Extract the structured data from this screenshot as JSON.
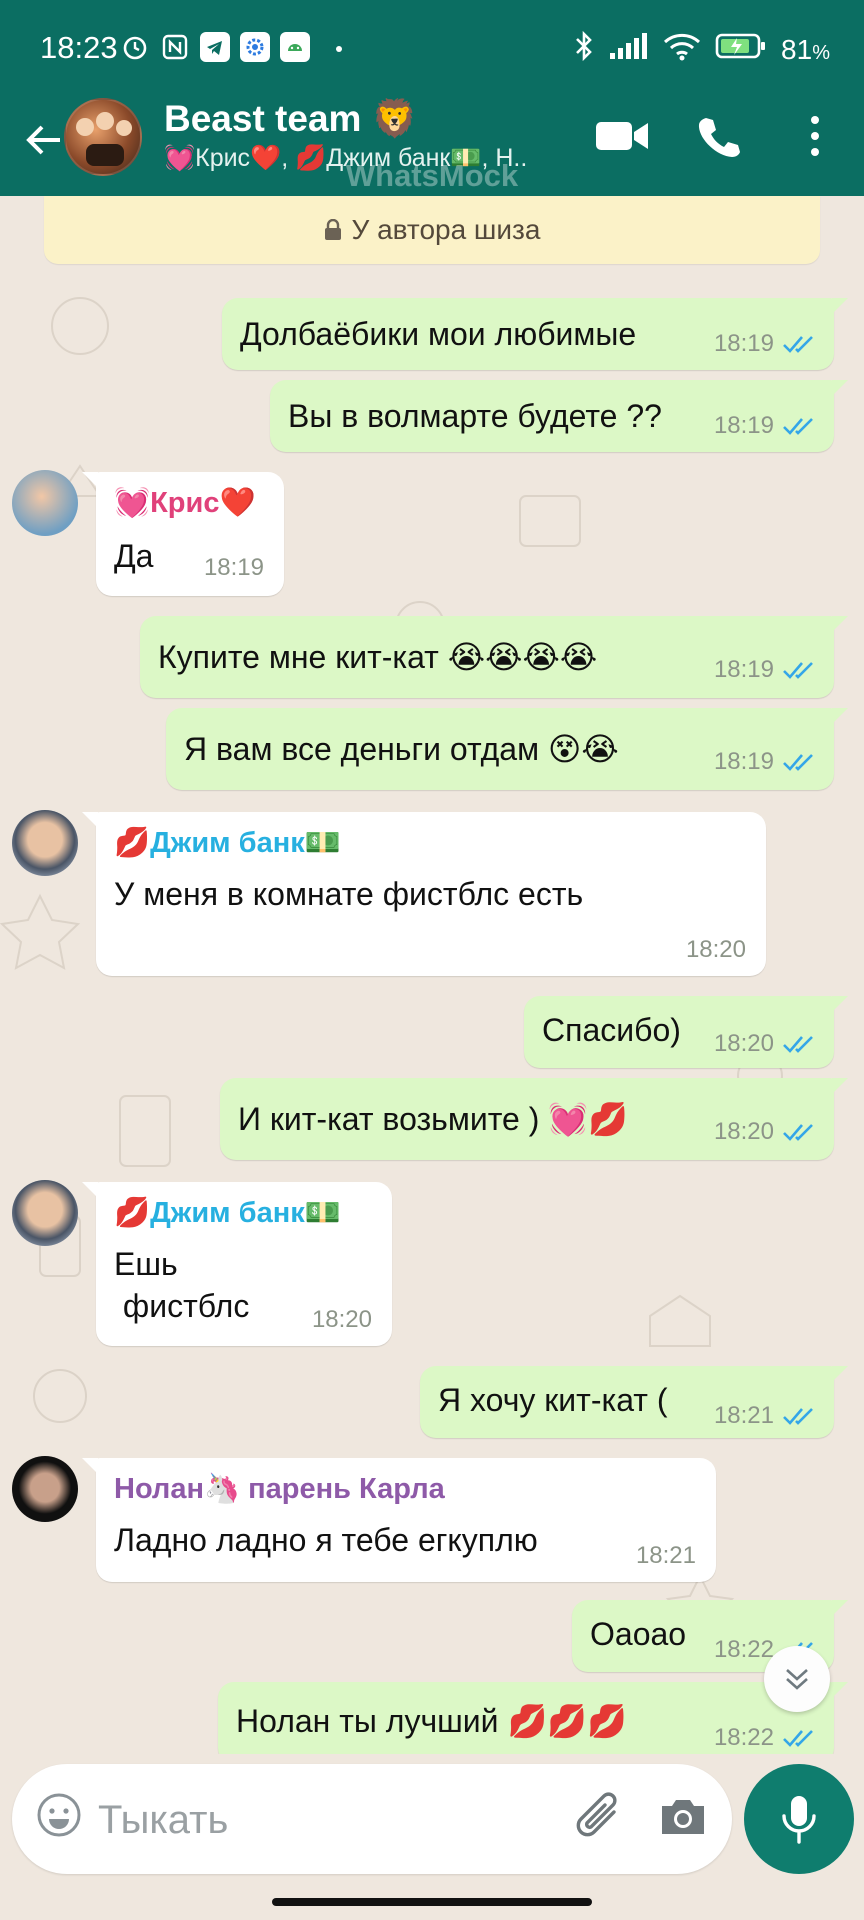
{
  "status_bar": {
    "time": "18:23",
    "battery": "81",
    "battery_unit": "%",
    "icons": [
      "alarm-icon",
      "nfc-icon",
      "telegram-icon",
      "settings-app-icon",
      "android-app-icon",
      "bluetooth-icon",
      "signal-icon",
      "wifi-icon",
      "battery-icon"
    ]
  },
  "header": {
    "title": "Beast team 🦁",
    "members": "💓Крис❤️, 💋Джим банк💵, Н..",
    "watermark": "WhatsMock"
  },
  "notice": {
    "text": "У автора шиза"
  },
  "messages": [
    {
      "dir": "out",
      "text": "Долбаёбики мои любимые",
      "time": "18:19",
      "status": "read"
    },
    {
      "dir": "out",
      "text": "Вы в волмарте будете ??",
      "time": "18:19",
      "status": "read"
    },
    {
      "dir": "in",
      "sender": "💓Крис❤️",
      "sender_color": "#e0417a",
      "text": "Да",
      "time": "18:19"
    },
    {
      "dir": "out",
      "text": "Купите мне кит-кат 😭😭😭😭",
      "time": "18:19",
      "status": "read"
    },
    {
      "dir": "out",
      "text": "Я вам все деньги отдам 😵😭",
      "time": "18:19",
      "status": "read"
    },
    {
      "dir": "in",
      "sender": "💋Джим банк💵",
      "sender_color": "#27b0e0",
      "text": "У меня в комнате фистблс есть",
      "time": "18:20"
    },
    {
      "dir": "out",
      "text": "Спасибо)",
      "time": "18:20",
      "status": "read"
    },
    {
      "dir": "out",
      "text": "И кит-кат возьмите ) 💓💋",
      "time": "18:20",
      "status": "read"
    },
    {
      "dir": "in",
      "sender": "💋Джим банк💵",
      "sender_color": "#27b0e0",
      "text_line1": "Ешь",
      "text_line2": " фистблс",
      "time": "18:20"
    },
    {
      "dir": "out",
      "text": "Я хочу кит-кат (",
      "time": "18:21",
      "status": "read"
    },
    {
      "dir": "in",
      "sender": "Нолан🦄 парень Карла",
      "sender_color": "#8e5aa8",
      "text": "Ладно ладно я тебе егкуплю",
      "time": "18:21"
    },
    {
      "dir": "out",
      "text": "Оаоао",
      "time": "18:22",
      "status": "read"
    },
    {
      "dir": "out",
      "text": "Нолан ты лучший 💋💋💋",
      "time": "18:22",
      "status": "read"
    }
  ],
  "input": {
    "placeholder": "Тыкать"
  },
  "colors": {
    "header": "#0b6e62",
    "outgoing_bubble": "#dcf8c6",
    "incoming_bubble": "#ffffff",
    "read_ticks": "#34a6e8",
    "mic_button": "#0f7d6e",
    "notice_bg": "#fbf2c8"
  }
}
